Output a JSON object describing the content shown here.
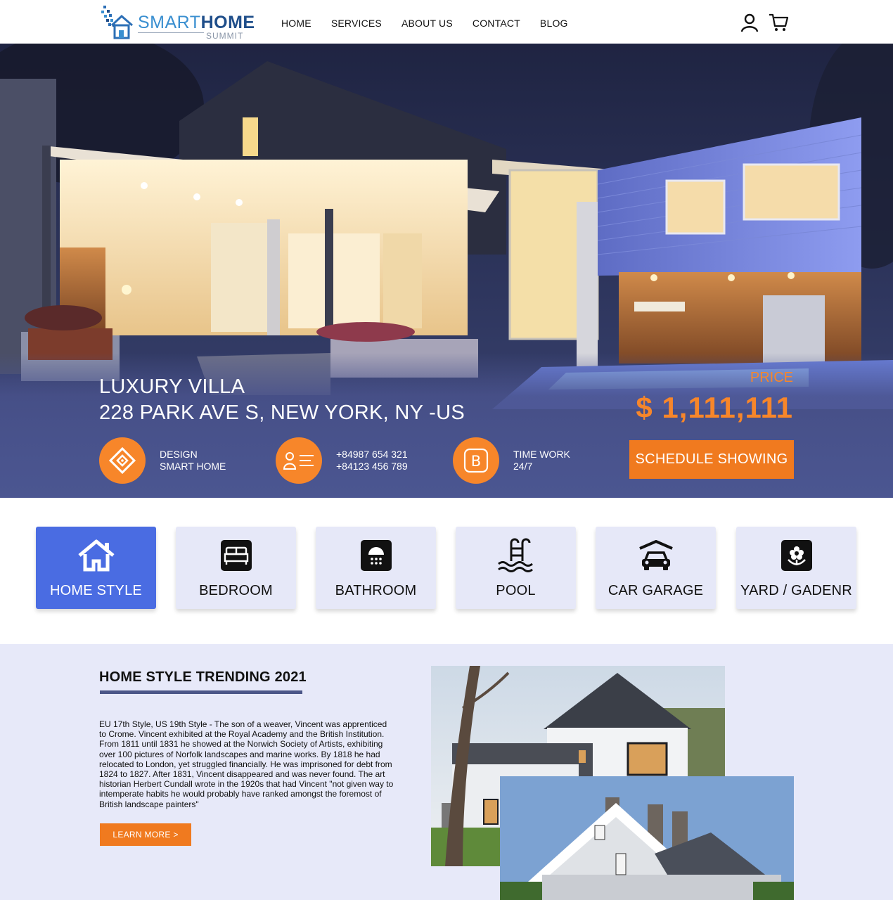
{
  "brand": {
    "name_part1": "SMART",
    "name_part2": "HOME",
    "sub": "SUMMIT"
  },
  "nav": [
    "HOME",
    "SERVICES",
    "ABOUT US",
    "CONTACT",
    "BLOG"
  ],
  "header_icons": [
    "user-icon",
    "cart-icon"
  ],
  "hero": {
    "title_line1": "LUXURY VILLA",
    "title_line2": "228 PARK AVE S, NEW YORK, NY -US",
    "price_label": "PRICE",
    "price_value": "$ 1,111,111",
    "features": [
      {
        "icon": "design-diamond-icon",
        "line1": "DESIGN",
        "line2": "SMART HOME"
      },
      {
        "icon": "contact-card-icon",
        "line1": "+84987 654 321",
        "line2": "+84123 456 789"
      },
      {
        "icon": "bootstrap-b-icon",
        "line1": "TIME WORK",
        "line2": "24/7"
      }
    ],
    "cta": "SCHEDULE SHOWING"
  },
  "categories": [
    {
      "label": "HOME STYLE",
      "icon": "house-icon",
      "active": true
    },
    {
      "label": "BEDROOM",
      "icon": "bed-icon",
      "active": false
    },
    {
      "label": "BATHROOM",
      "icon": "shower-icon",
      "active": false
    },
    {
      "label": "POOL",
      "icon": "pool-ladder-icon",
      "active": false
    },
    {
      "label": "CAR GARAGE",
      "icon": "car-garage-icon",
      "active": false
    },
    {
      "label": "YARD / GADENR",
      "icon": "flower-icon",
      "active": false
    }
  ],
  "trending": {
    "title": "HOME STYLE TRENDING 2021",
    "body": "EU 17th Style, US 19th Style - The son of a weaver, Vincent was apprenticed to Crome. Vincent exhibited at the Royal Academy and the British Institution. From 1811 until 1831 he showed at the Norwich Society of Artists, exhibiting over 100 pictures of Norfolk landscapes and marine works. By 1818 he had relocated to London, yet struggled financially. He was imprisoned for debt from 1824 to 1827. After 1831, Vincent disappeared and was never found. The art historian Herbert Cundall wrote in the 1920s that had Vincent \"not given way to intemperate habits he would probably have ranked amongst the foremost of British landscape painters\"",
    "button": "LEARN MORE >"
  },
  "colors": {
    "accent": "#f7862a",
    "primary": "#4a6ce2",
    "hero_bg": "#4b5691",
    "card_bg": "#e6e8f8",
    "section_bg": "#e7e9f9"
  }
}
